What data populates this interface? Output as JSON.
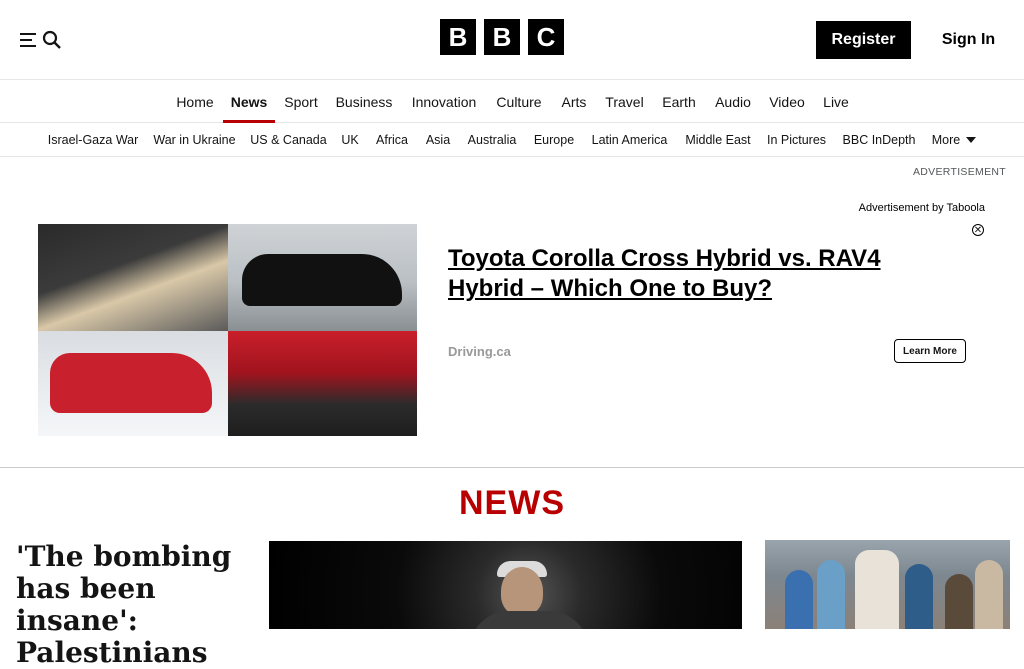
{
  "header": {
    "logo_letters": [
      "B",
      "B",
      "C"
    ],
    "register_label": "Register",
    "signin_label": "Sign In"
  },
  "primary_nav": [
    {
      "label": "Home"
    },
    {
      "label": "News",
      "active": true
    },
    {
      "label": "Sport"
    },
    {
      "label": "Business"
    },
    {
      "label": "Innovation"
    },
    {
      "label": "Culture"
    },
    {
      "label": "Arts"
    },
    {
      "label": "Travel"
    },
    {
      "label": "Earth"
    },
    {
      "label": "Audio"
    },
    {
      "label": "Video"
    },
    {
      "label": "Live"
    }
  ],
  "secondary_nav": [
    {
      "label": "Israel-Gaza War"
    },
    {
      "label": "War in Ukraine"
    },
    {
      "label": "US & Canada"
    },
    {
      "label": "UK"
    },
    {
      "label": "Africa"
    },
    {
      "label": "Asia"
    },
    {
      "label": "Australia"
    },
    {
      "label": "Europe"
    },
    {
      "label": "Latin America"
    },
    {
      "label": "Middle East"
    },
    {
      "label": "In Pictures"
    },
    {
      "label": "BBC InDepth"
    },
    {
      "label": "More"
    }
  ],
  "ad": {
    "label": "ADVERTISEMENT",
    "by": "Advertisement by Taboola",
    "close_glyph": "✕",
    "title": "Toyota Corolla Cross Hybrid vs. RAV4 Hybrid – Which One to Buy?",
    "source": "Driving.ca",
    "cta": "Learn More"
  },
  "news_section": {
    "title": "NEWS",
    "lead_headline": "'The bombing has been insane': Palestinians"
  },
  "colors": {
    "accent": "#b80000",
    "text": "#141414",
    "border": "#e6e6e6"
  }
}
